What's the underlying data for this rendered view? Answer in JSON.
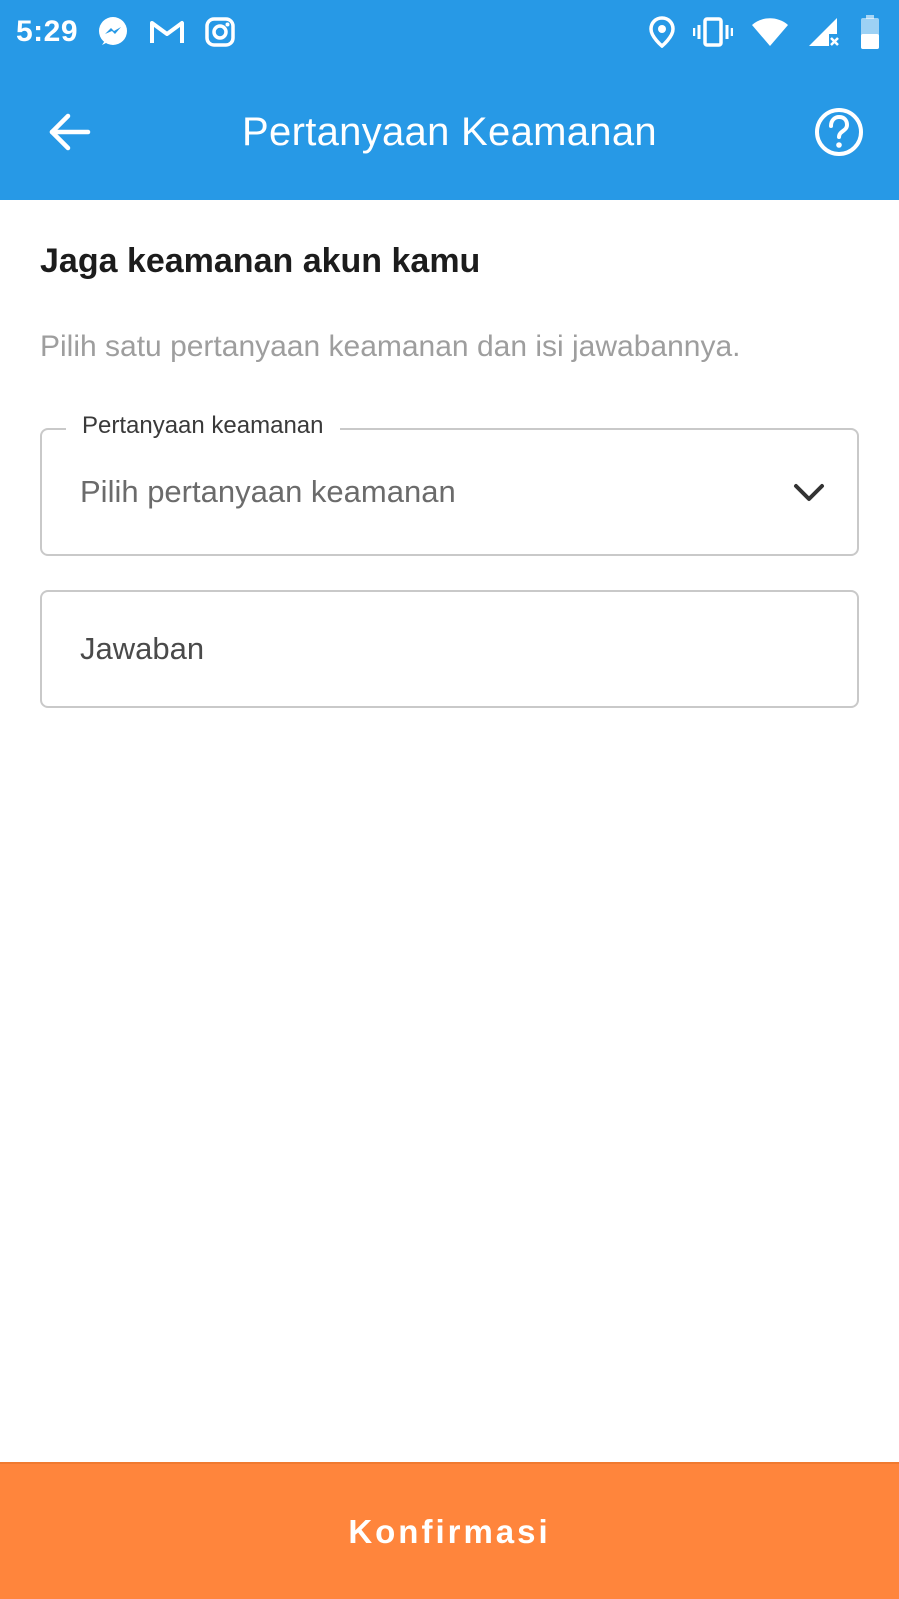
{
  "status_bar": {
    "time": "5:29",
    "icons_left": [
      "messenger-icon",
      "gmail-icon",
      "instagram-icon"
    ],
    "icons_right": [
      "location-icon",
      "vibrate-icon",
      "wifi-icon",
      "signal-icon",
      "battery-icon"
    ]
  },
  "app_bar": {
    "title": "Pertanyaan Keamanan",
    "back_icon": "arrow-left-icon",
    "help_icon": "help-circle-icon"
  },
  "main": {
    "heading": "Jaga keamanan akun kamu",
    "description": "Pilih satu pertanyaan keamanan dan isi jawabannya.",
    "question_field": {
      "label": "Pertanyaan keamanan",
      "placeholder": "Pilih pertanyaan keamanan"
    },
    "answer_field": {
      "placeholder": "Jawaban",
      "value": ""
    }
  },
  "footer": {
    "confirm_label": "Konfirmasi"
  },
  "colors": {
    "primary": "#2799e6",
    "accent": "#ff853c"
  }
}
